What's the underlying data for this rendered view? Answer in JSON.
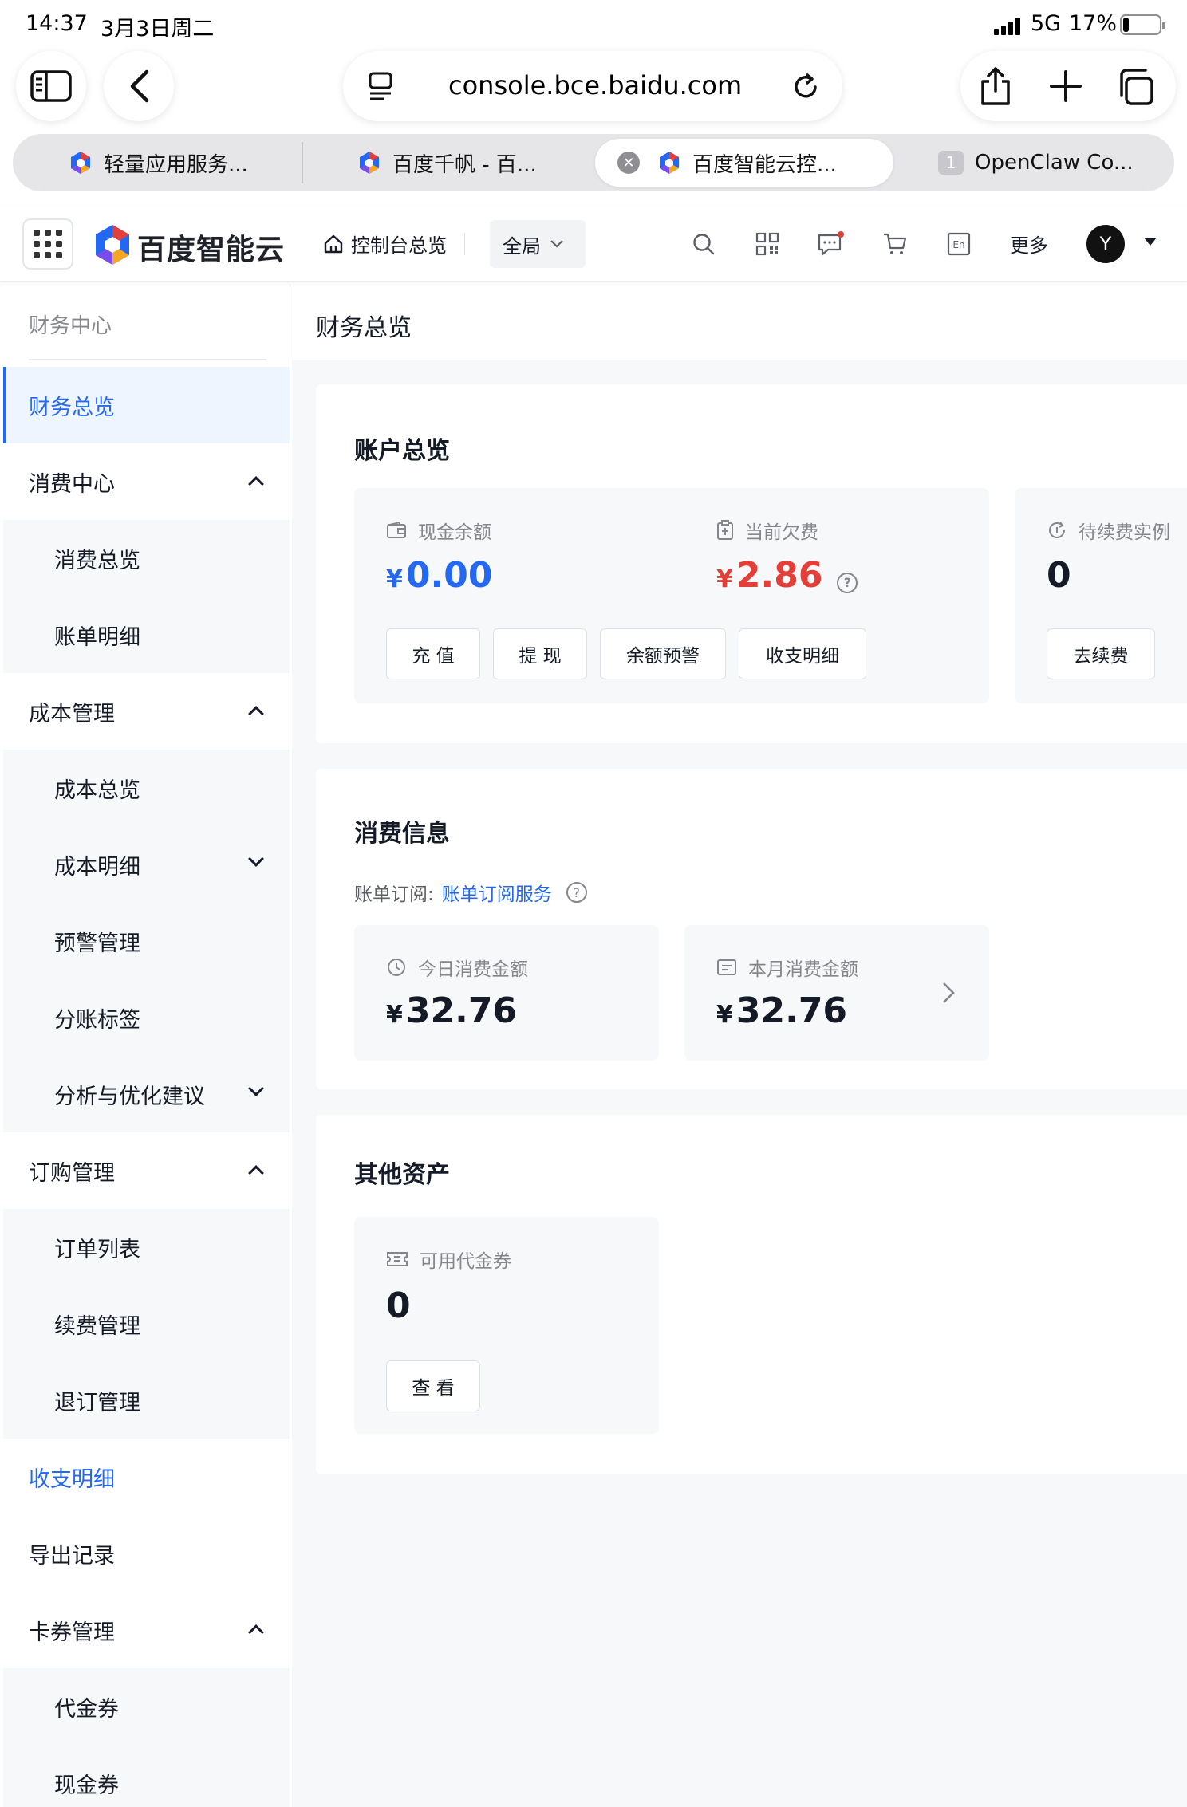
{
  "status_bar": {
    "time": "14:37",
    "date": "3月3日周二",
    "network": "5G",
    "battery": "17%",
    "battery_level": 0.17
  },
  "browser": {
    "url": "console.bce.baidu.com",
    "tabs": [
      {
        "label": "轻量应用服务..."
      },
      {
        "label": "百度千帆 - 百..."
      },
      {
        "label": "百度智能云控..."
      },
      {
        "label": "OpenClaw Co...",
        "badge": "1"
      }
    ]
  },
  "header": {
    "brand": "百度智能云",
    "home": "控制台总览",
    "region": "全局",
    "more": "更多",
    "avatar": "Y",
    "icons": [
      "search-icon",
      "qrcode-icon",
      "message-icon",
      "cart-icon",
      "language-icon"
    ]
  },
  "sidebar": {
    "title": "财务中心",
    "items": [
      {
        "label": "财务总览"
      },
      {
        "label": "消费中心"
      },
      {
        "label": "消费总览"
      },
      {
        "label": "账单明细"
      },
      {
        "label": "成本管理"
      },
      {
        "label": "成本总览"
      },
      {
        "label": "成本明细"
      },
      {
        "label": "预警管理"
      },
      {
        "label": "分账标签"
      },
      {
        "label": "分析与优化建议"
      },
      {
        "label": "订购管理"
      },
      {
        "label": "订单列表"
      },
      {
        "label": "续费管理"
      },
      {
        "label": "退订管理"
      },
      {
        "label": "收支明细"
      },
      {
        "label": "导出记录"
      },
      {
        "label": "卡券管理"
      },
      {
        "label": "代金券"
      },
      {
        "label": "现金券"
      }
    ]
  },
  "main": {
    "page_title": "财务总览",
    "account": {
      "title": "账户总览",
      "cash_label": "现金余额",
      "currency": "¥",
      "cash_value": "0.00",
      "debt_label": "当前欠费",
      "debt_value": "2.86",
      "renew_label": "待续费实例",
      "renew_value": "0",
      "buttons": {
        "recharge": "充 值",
        "withdraw": "提 现",
        "alert": "余额预警",
        "detail": "收支明细",
        "renew": "去续费"
      }
    },
    "consumption": {
      "title": "消费信息",
      "subscribe_label": "账单订阅:",
      "subscribe_link": "账单订阅服务",
      "today_label": "今日消费金额",
      "today_value": "32.76",
      "month_label": "本月消费金额",
      "month_value": "32.76"
    },
    "assets": {
      "title": "其他资产",
      "voucher_label": "可用代金券",
      "voucher_value": "0",
      "view_button": "查 看"
    }
  },
  "colors": {
    "accent": "#2468f2",
    "danger": "#e33e37",
    "text": "#151b26",
    "muted": "#84868c"
  }
}
